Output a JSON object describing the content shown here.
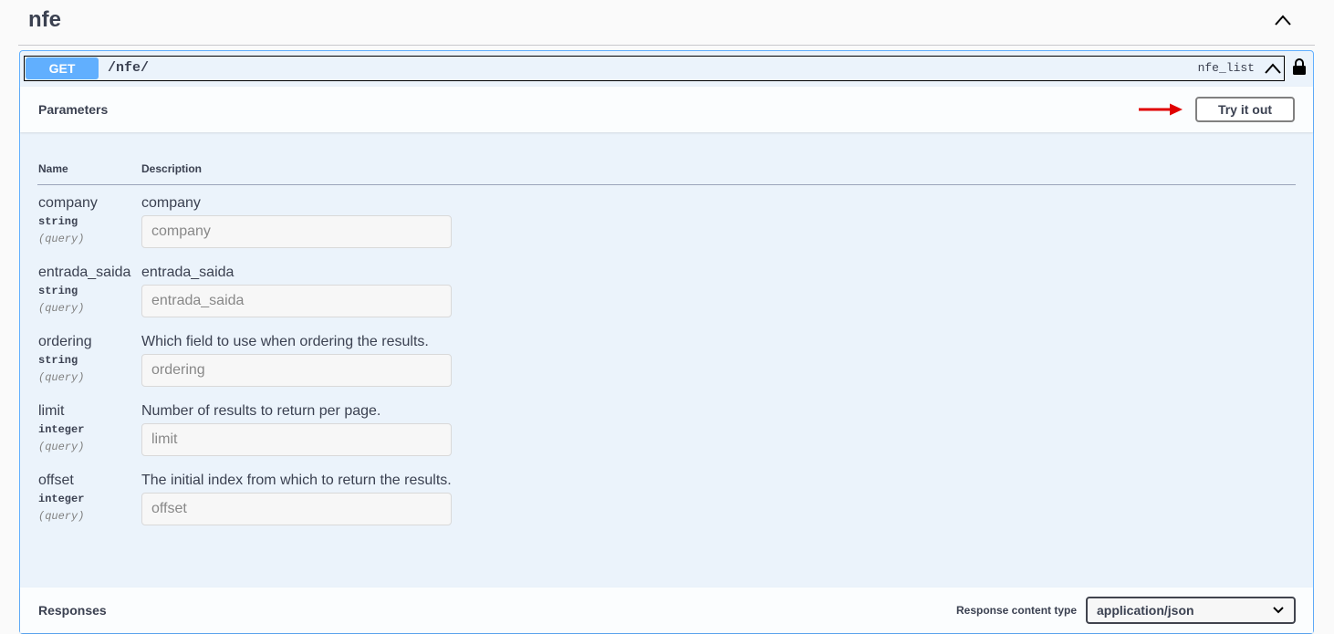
{
  "tag": {
    "title": "nfe"
  },
  "operation": {
    "method": "GET",
    "path": "/nfe/",
    "operation_id": "nfe_list"
  },
  "parameters_section": {
    "title": "Parameters",
    "try_button": "Try it out",
    "col_name": "Name",
    "col_description": "Description"
  },
  "parameters": [
    {
      "name": "company",
      "type": "string",
      "in": "(query)",
      "description": "company",
      "placeholder": "company"
    },
    {
      "name": "entrada_saida",
      "type": "string",
      "in": "(query)",
      "description": "entrada_saida",
      "placeholder": "entrada_saida"
    },
    {
      "name": "ordering",
      "type": "string",
      "in": "(query)",
      "description": "Which field to use when ordering the results.",
      "placeholder": "ordering"
    },
    {
      "name": "limit",
      "type": "integer",
      "in": "(query)",
      "description": "Number of results to return per page.",
      "placeholder": "limit"
    },
    {
      "name": "offset",
      "type": "integer",
      "in": "(query)",
      "description": "The initial index from which to return the results.",
      "placeholder": "offset"
    }
  ],
  "responses_section": {
    "title": "Responses",
    "content_type_label": "Response content type",
    "content_type_value": "application/json"
  },
  "colors": {
    "get_method": "#61affe",
    "arrow": "#e00000"
  }
}
